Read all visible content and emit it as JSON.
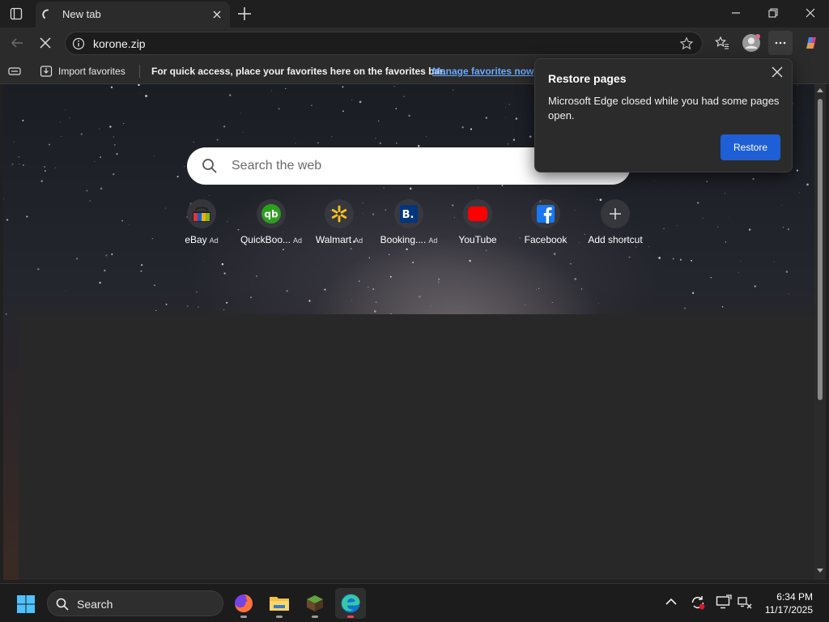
{
  "tab": {
    "title": "New tab"
  },
  "address": {
    "url": "korone.zip"
  },
  "favbar": {
    "import_label": "Import favorites",
    "hint": "For quick access, place your favorites here on the favorites bar.",
    "manage_link": "Manage favorites now"
  },
  "search": {
    "placeholder": "Search the web"
  },
  "shortcuts": [
    {
      "label": "eBay",
      "ad": "Ad",
      "icon": "ebay-icon"
    },
    {
      "label": "QuickBoo...",
      "ad": "Ad",
      "icon": "quickbooks-icon"
    },
    {
      "label": "Walmart",
      "ad": "Ad",
      "icon": "walmart-icon"
    },
    {
      "label": "Booking....",
      "ad": "Ad",
      "icon": "booking-icon"
    },
    {
      "label": "YouTube",
      "ad": "",
      "icon": "youtube-icon"
    },
    {
      "label": "Facebook",
      "ad": "",
      "icon": "facebook-icon"
    },
    {
      "label": "Add shortcut",
      "ad": "",
      "icon": "plus-icon"
    }
  ],
  "popup": {
    "title": "Restore pages",
    "message": "Microsoft Edge closed while you had some pages open.",
    "button": "Restore"
  },
  "taskbar": {
    "search_label": "Search",
    "time": "6:34 PM",
    "date": "11/17/2025"
  },
  "colors": {
    "accent": "#1e5fd6",
    "link": "#6aa9ff"
  }
}
